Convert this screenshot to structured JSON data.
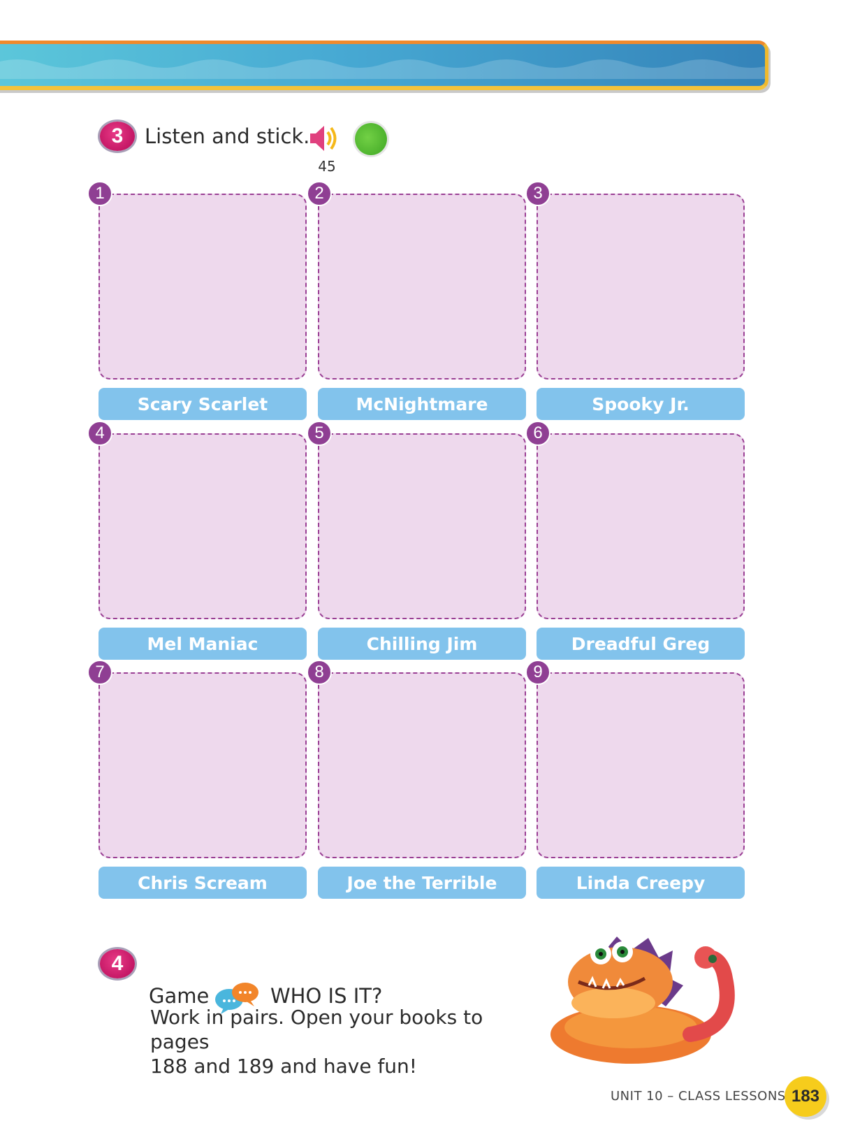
{
  "activity3": {
    "number": "3",
    "instruction": "Listen and stick.",
    "track": "45",
    "icons": [
      "speaker-icon",
      "sticker-icon"
    ]
  },
  "grid": {
    "cells": [
      {
        "num": "1",
        "name": "Scary Scarlet"
      },
      {
        "num": "2",
        "name": "McNightmare"
      },
      {
        "num": "3",
        "name": "Spooky Jr."
      },
      {
        "num": "4",
        "name": "Mel Maniac"
      },
      {
        "num": "5",
        "name": "Chilling Jim"
      },
      {
        "num": "6",
        "name": "Dreadful Greg"
      },
      {
        "num": "7",
        "name": "Chris Scream"
      },
      {
        "num": "8",
        "name": "Joe the Terrible"
      },
      {
        "num": "9",
        "name": "Linda Creepy"
      }
    ]
  },
  "activity4": {
    "number": "4",
    "label": "Game",
    "title": "WHO IS IT?",
    "line1": "Work in pairs. Open your books to pages",
    "line2": "188 and 189 and have fun!"
  },
  "footer": {
    "unit": "UNIT 10 – CLASS LESSONS",
    "page": "183"
  },
  "colors": {
    "accent_pink": "#c41765",
    "sticker_bg": "#eed9ed",
    "label_blue": "#82c3ec",
    "badge_purple": "#8f3f93",
    "page_badge": "#f6cc1c"
  }
}
